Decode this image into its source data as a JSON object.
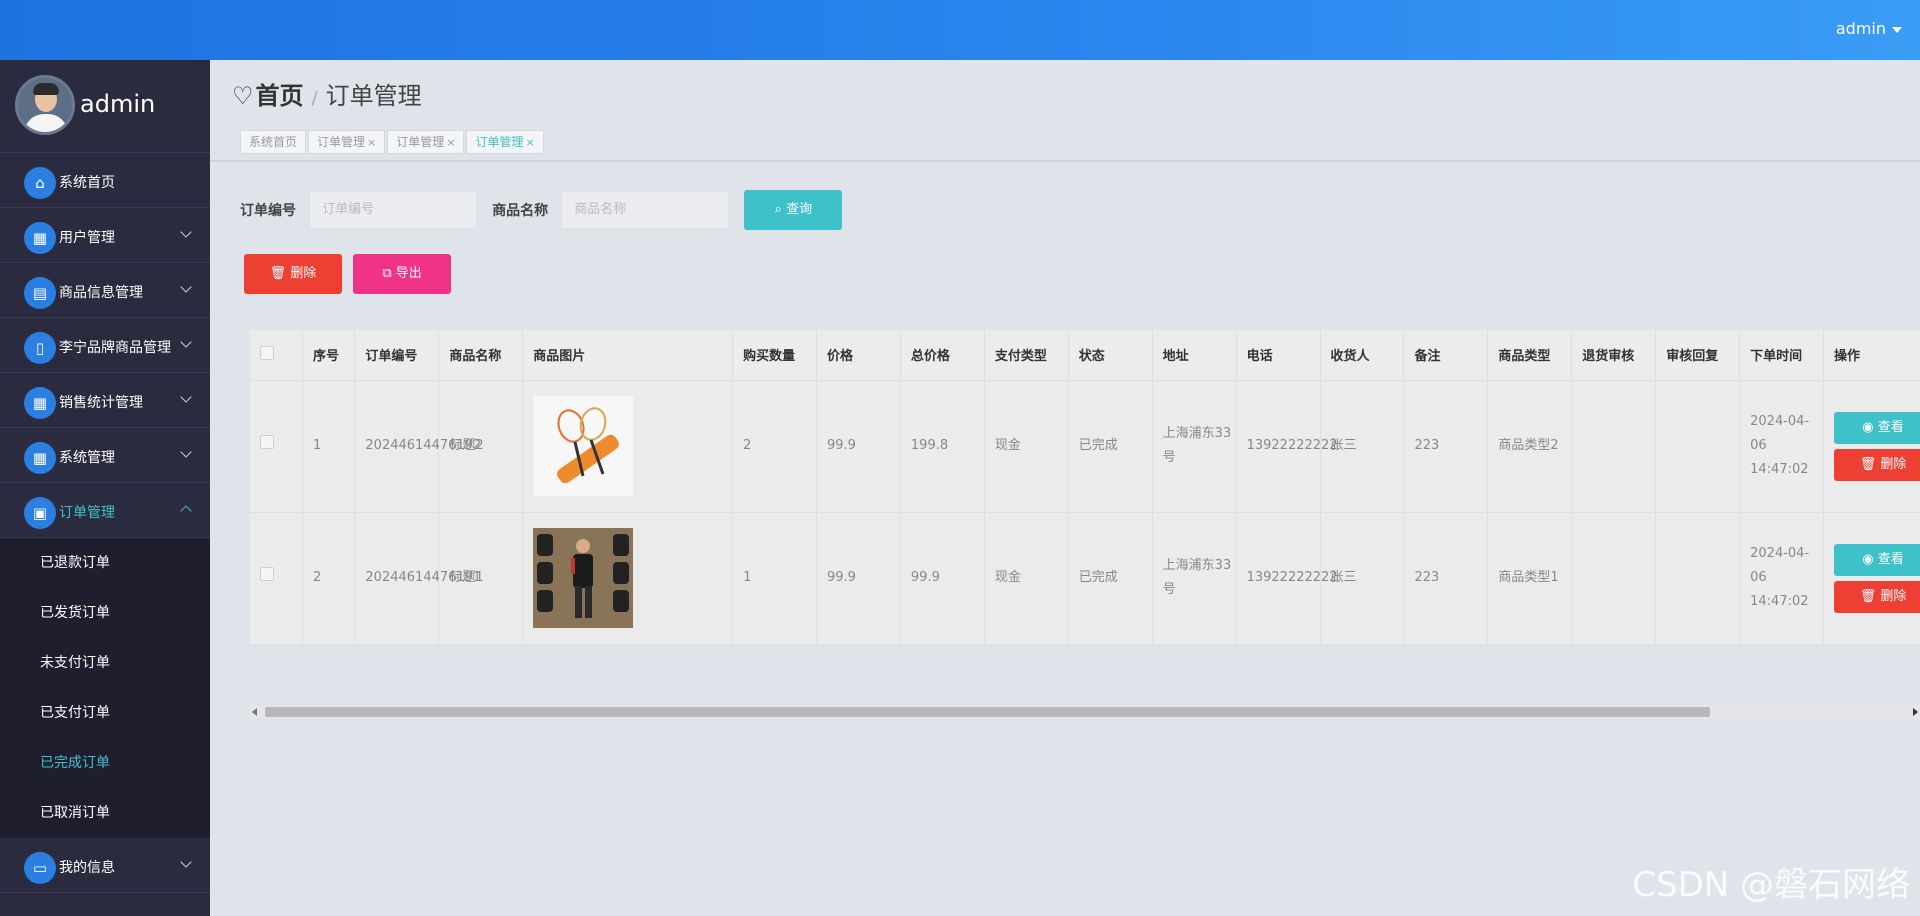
{
  "topbar": {
    "user": "admin"
  },
  "sidebar": {
    "profile_name": "admin",
    "items": [
      {
        "label": "系统首页",
        "icon": "home-icon",
        "glyph": "⌂",
        "has_children": false
      },
      {
        "label": "用户管理",
        "icon": "grid-icon",
        "glyph": "▦",
        "has_children": true
      },
      {
        "label": "商品信息管理",
        "icon": "clipboard-icon",
        "glyph": "▤",
        "has_children": true
      },
      {
        "label": "李宁品牌商品管理",
        "icon": "phone-icon",
        "glyph": "▯",
        "has_children": true
      },
      {
        "label": "销售统计管理",
        "icon": "grid-icon",
        "glyph": "▦",
        "has_children": true
      },
      {
        "label": "系统管理",
        "icon": "grid-icon",
        "glyph": "▦",
        "has_children": true
      },
      {
        "label": "订单管理",
        "icon": "box-icon",
        "glyph": "▣",
        "has_children": true,
        "open": true
      },
      {
        "label": "我的信息",
        "icon": "card-icon",
        "glyph": "▭",
        "has_children": true
      }
    ],
    "submenu": [
      "已退款订单",
      "已发货订单",
      "未支付订单",
      "已支付订单",
      "已完成订单",
      "已取消订单"
    ],
    "active_sub": "已完成订单"
  },
  "header": {
    "home": "首页",
    "separator": "/",
    "current": "订单管理",
    "tags": [
      {
        "label": "系统首页",
        "closable": false
      },
      {
        "label": "订单管理",
        "closable": true
      },
      {
        "label": "订单管理",
        "closable": true
      },
      {
        "label": "订单管理",
        "closable": true,
        "active": true
      }
    ],
    "close_glyph": "×"
  },
  "search": {
    "order_no_label": "订单编号",
    "order_no_placeholder": "订单编号",
    "product_label": "商品名称",
    "product_placeholder": "商品名称",
    "query_label": "查询"
  },
  "toolbar": {
    "delete_label": "删除",
    "export_label": "导出"
  },
  "table": {
    "columns": [
      "序号",
      "订单编号",
      "商品名称",
      "商品图片",
      "购买数量",
      "价格",
      "总价格",
      "支付类型",
      "状态",
      "地址",
      "电话",
      "收货人",
      "备注",
      "商品类型",
      "退货审核",
      "审核回复",
      "下单时间",
      "操作"
    ],
    "rows": [
      {
        "index": "1",
        "order_no": "20244614476192",
        "name": "标题2",
        "qty": "2",
        "price": "99.9",
        "total": "199.8",
        "pay_type": "现金",
        "status": "已完成",
        "address": "上海浦东33号",
        "phone": "13922222222",
        "receiver": "张三",
        "note": "223",
        "category": "商品类型2",
        "return_audit": "",
        "audit_reply": "",
        "time": "2024-04-06 14:47:02"
      },
      {
        "index": "2",
        "order_no": "20244614476191",
        "name": "标题1",
        "qty": "1",
        "price": "99.9",
        "total": "99.9",
        "pay_type": "现金",
        "status": "已完成",
        "address": "上海浦东33号",
        "phone": "13922222222",
        "receiver": "张三",
        "note": "223",
        "category": "商品类型1",
        "return_audit": "",
        "audit_reply": "",
        "time": "2024-04-06 14:47:02"
      }
    ],
    "view_label": "查看",
    "remove_label": "删除"
  },
  "watermark": "CSDN @磐石网络",
  "colors": {
    "topbar": "#1e73df",
    "sidebar": "#2b2b3f",
    "accent": "#3fc1c9",
    "danger": "#ee3f34",
    "pink": "#f03386"
  }
}
